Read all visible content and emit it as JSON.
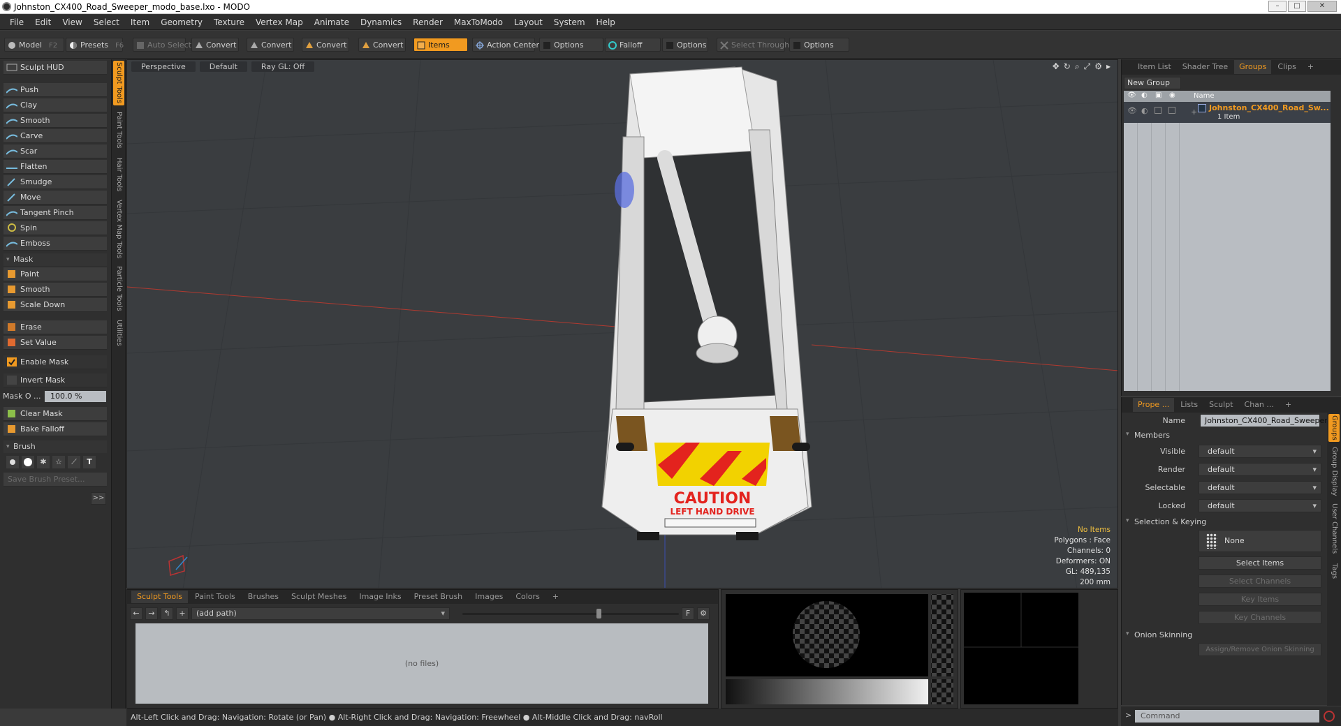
{
  "window": {
    "title": "Johnston_CX400_Road_Sweeper_modo_base.lxo - MODO"
  },
  "menu": [
    "File",
    "Edit",
    "View",
    "Select",
    "Item",
    "Geometry",
    "Texture",
    "Vertex Map",
    "Animate",
    "Dynamics",
    "Render",
    "MaxToModo",
    "Layout",
    "System",
    "Help"
  ],
  "toolbar": {
    "model": "Model",
    "model_key": "F2",
    "presets": "Presets",
    "presets_key": "F6",
    "auto_select": "Auto Select",
    "convert": "Convert",
    "items": "Items",
    "action_center": "Action Center",
    "options": "Options",
    "falloff": "Falloff",
    "select_through": "Select Through"
  },
  "sculpt": {
    "hud": "Sculpt HUD",
    "tools": [
      "Push",
      "Clay",
      "Smooth",
      "Carve",
      "Scar",
      "Flatten",
      "Smudge",
      "Move",
      "Tangent Pinch",
      "Spin",
      "Emboss"
    ],
    "mask_section": "Mask",
    "mask_tools": [
      "Paint",
      "Smooth",
      "Scale Down"
    ],
    "erase": "Erase",
    "set_value": "Set Value",
    "enable_mask": "Enable Mask",
    "invert_mask": "Invert Mask",
    "mask_opacity_label": "Mask O ...",
    "mask_opacity_value": "100.0 %",
    "clear_mask": "Clear Mask",
    "bake_falloff": "Bake Falloff",
    "brush_section": "Brush",
    "save_brush": "Save Brush Preset...",
    "expand": ">>"
  },
  "vtabs": [
    "Sculpt Tools",
    "Paint Tools",
    "Hair Tools",
    "Vertex Map Tools",
    "Particle Tools",
    "Utilities"
  ],
  "viewport": {
    "view": "Perspective",
    "shading": "Default",
    "raygl": "Ray GL: Off",
    "stats": {
      "items": "No Items",
      "polygons": "Polygons : Face",
      "channels": "Channels: 0",
      "deformers": "Deformers: ON",
      "gl": "GL: 489,135",
      "scale": "200 mm"
    },
    "decal": {
      "caution": "CAUTION",
      "subtitle": "LEFT HAND DRIVE"
    }
  },
  "bottom": {
    "tabs": [
      "Sculpt Tools",
      "Paint Tools",
      "Brushes",
      "Sculpt Meshes",
      "Image Inks",
      "Preset Brush",
      "Images",
      "Colors",
      "+"
    ],
    "path": "(add path)",
    "zoom": 0.62,
    "empty": "(no files)",
    "f_button": "F"
  },
  "groups_panel": {
    "tabs": [
      "Item List",
      "Shader Tree",
      "Groups",
      "Clips",
      "+"
    ],
    "new_group": "New Group",
    "header_name": "Name",
    "group_name": "Johnston_CX400_Road_Sw...",
    "group_count": "1 Item"
  },
  "properties": {
    "tabs": [
      "Prope ...",
      "Lists",
      "Sculpt",
      "Chan ...",
      "+"
    ],
    "name_label": "Name",
    "name_value": "Johnston_CX400_Road_Sweeper",
    "members": "Members",
    "visible_label": "Visible",
    "visible": "default",
    "render_label": "Render",
    "render": "default",
    "selectable_label": "Selectable",
    "selectable": "default",
    "locked_label": "Locked",
    "locked": "default",
    "sel_keying": "Selection & Keying",
    "none": "None",
    "select_items": "Select Items",
    "select_channels": "Select Channels",
    "key_items": "Key Items",
    "key_channels": "Key Channels",
    "onion": "Onion Skinning",
    "onion_btn": "Assign/Remove Onion Skinning",
    "side_tabs": [
      "Groups",
      "Group Display",
      "User Channels",
      "Tags"
    ]
  },
  "status": "Alt-Left Click and Drag: Navigation: Rotate (or Pan) ● Alt-Right Click and Drag: Navigation: Freewheel ● Alt-Middle Click and Drag: navRoll",
  "command": {
    "placeholder": "Command"
  },
  "colors": {
    "accent": "#f19a20",
    "panel": "#2f2f2f",
    "viewport": "#3a3d40"
  }
}
